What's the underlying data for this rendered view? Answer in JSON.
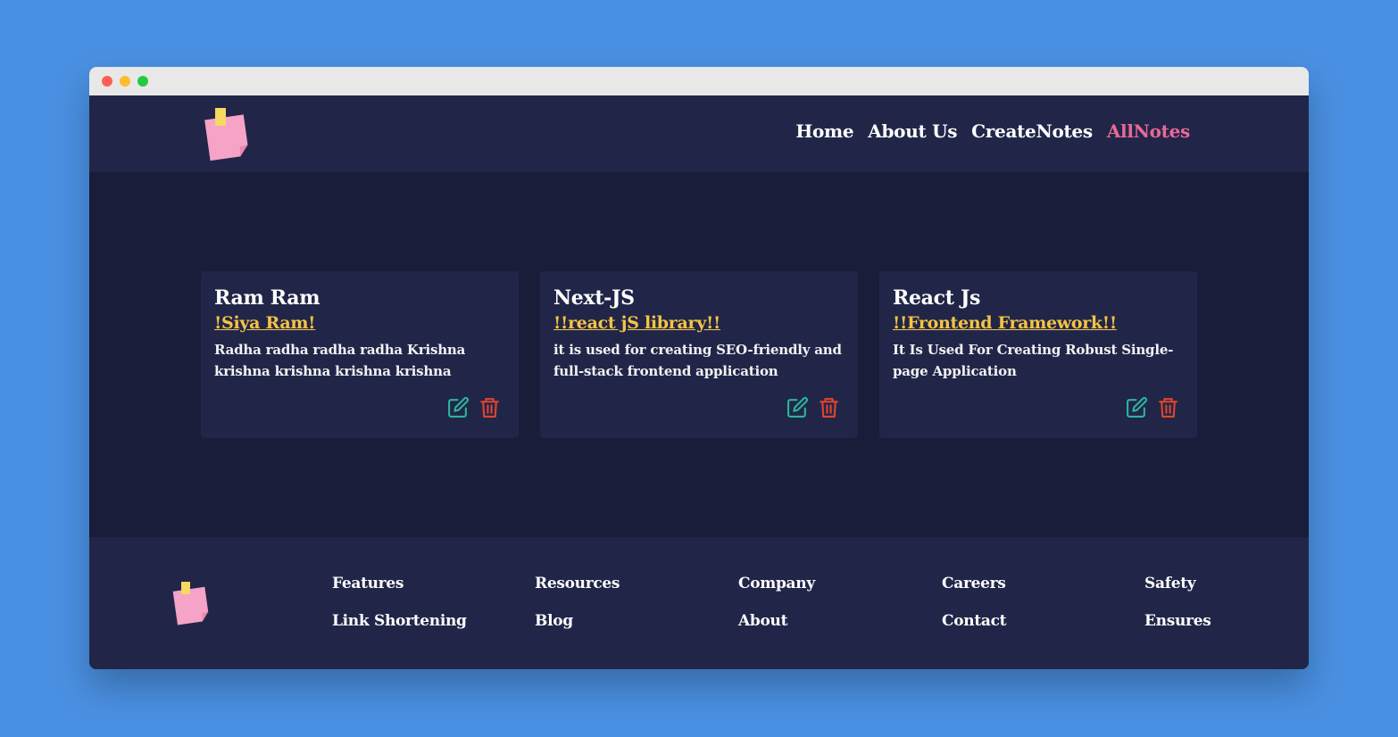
{
  "colors": {
    "background": "#4a90e2",
    "navbar": "#212649",
    "main": "#191d39",
    "card": "#212649",
    "accent": "#e86a95",
    "tag": "#f6c443",
    "edit_icon": "#2bb59a",
    "delete_icon": "#e2452d"
  },
  "nav": {
    "links": [
      {
        "label": "Home"
      },
      {
        "label": "About Us"
      },
      {
        "label": "CreateNotes"
      },
      {
        "label": "AllNotes"
      }
    ]
  },
  "notes": [
    {
      "title": "Ram Ram",
      "tag": "!Siya Ram!",
      "description": "Radha radha radha radha Krishna krishna krishna krishna krishna"
    },
    {
      "title": "Next-JS",
      "tag": "!!react jS library!!",
      "description": "it is used for creating SEO-friendly and full-stack frontend application"
    },
    {
      "title": "React Js",
      "tag": "!!Frontend Framework!!",
      "description": "It Is Used For Creating Robust Single-page Application"
    }
  ],
  "icons": {
    "logo": "sticky-note-icon",
    "edit": "edit-icon",
    "delete": "trash-icon"
  },
  "footer": {
    "columns": [
      {
        "links": [
          "Features",
          "Link Shortening"
        ]
      },
      {
        "links": [
          "Resources",
          "Blog"
        ]
      },
      {
        "links": [
          "Company",
          "About"
        ]
      },
      {
        "links": [
          "Careers",
          "Contact"
        ]
      },
      {
        "links": [
          "Safety",
          "Ensures"
        ]
      }
    ]
  }
}
